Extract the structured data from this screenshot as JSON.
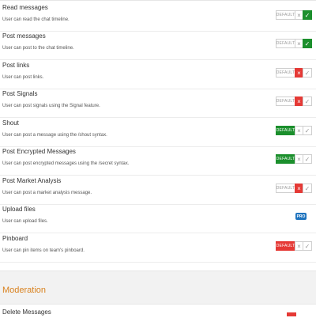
{
  "permissions": [
    {
      "title": "Read messages",
      "desc": "User can read the chat timeline.",
      "state": "allow",
      "default_label": "DEFAULT",
      "x_label": "×",
      "check_label": "✓"
    },
    {
      "title": "Post messages",
      "desc": "User can post to the chat timeline.",
      "state": "allow",
      "default_label": "DEFAULT",
      "x_label": "×",
      "check_label": "✓"
    },
    {
      "title": "Post links",
      "desc": "User can post links.",
      "state": "deny",
      "default_label": "DEFAULT",
      "x_label": "×",
      "check_label": "✓"
    },
    {
      "title": "Post Signals",
      "desc": "User can post signals using the Signal feature.",
      "state": "deny",
      "default_label": "DEFAULT",
      "x_label": "×",
      "check_label": "✓"
    },
    {
      "title": "Shout",
      "desc": "User can post a message using the /shout syntax.",
      "state": "default-allow",
      "default_label": "DEFAULT",
      "x_label": "×",
      "check_label": "✓"
    },
    {
      "title": "Post Encrypted Messages",
      "desc": "User can post encrypted messages using the /secret syntax.",
      "state": "default-allow",
      "default_label": "DEFAULT",
      "x_label": "×",
      "check_label": "✓"
    },
    {
      "title": "Post Market Analysis",
      "desc": "User can post a market analysis message.",
      "state": "deny",
      "default_label": "DEFAULT",
      "x_label": "×",
      "check_label": "✓"
    },
    {
      "title": "Upload files",
      "desc": "User can upload files.",
      "state": "badge",
      "badge_label": "PRO"
    },
    {
      "title": "Pinboard",
      "desc": "User can pin items on team's pinboard.",
      "state": "default-deny",
      "default_label": "DEFAULT",
      "x_label": "×",
      "check_label": "✓"
    }
  ],
  "moderation": {
    "section_title": "Moderation",
    "first_item_title": "Delete Messages"
  },
  "colors": {
    "allow": "#1b8f2c",
    "deny": "#e53935",
    "accent": "#d9821f",
    "badge": "#1e73be"
  }
}
